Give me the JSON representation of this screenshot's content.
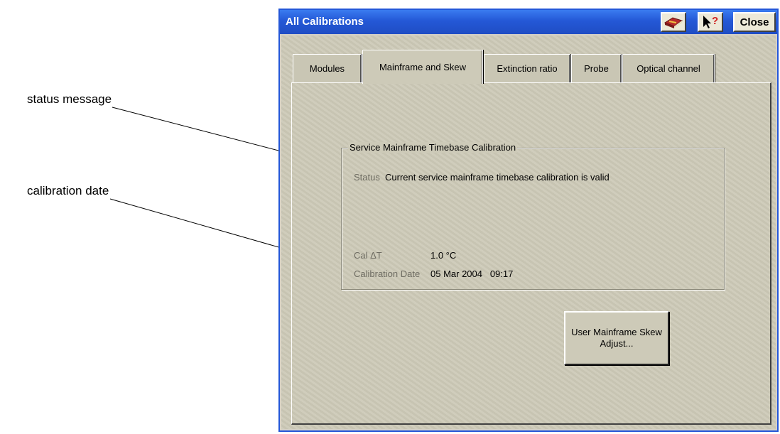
{
  "callouts": {
    "status_message": "status message",
    "calibration_date": "calibration date"
  },
  "window": {
    "title": "All Calibrations",
    "close_label": "Close",
    "help_icon": "help-book-icon",
    "pointer_help_icon": "whats-this-pointer-icon"
  },
  "tabs": [
    {
      "label": "Modules",
      "active": false
    },
    {
      "label": "Mainframe and Skew",
      "active": true
    },
    {
      "label": "Extinction ratio",
      "active": false
    },
    {
      "label": "Probe",
      "active": false
    },
    {
      "label": "Optical channel",
      "active": false
    }
  ],
  "group": {
    "title": "Service Mainframe Timebase Calibration",
    "status_label": "Status",
    "status_value": "Current service mainframe timebase calibration is valid",
    "cal_dt_label": "Cal ΔT",
    "cal_dt_value": "1.0 °C",
    "cal_date_label": "Calibration Date",
    "cal_date_value": "05 Mar 2004   09:17"
  },
  "actions": {
    "skew_adjust_label": "User Mainframe Skew Adjust..."
  },
  "colors": {
    "titlebar": "#2458d6",
    "panel": "#cdcab8"
  }
}
